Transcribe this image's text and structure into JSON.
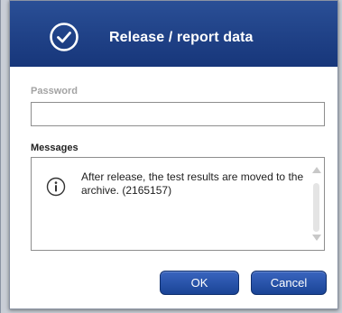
{
  "dialog": {
    "title": "Release / report data",
    "header_icon": "check-circle-icon",
    "accent_color": "#1f4389"
  },
  "password": {
    "label": "Password",
    "value": "",
    "placeholder": ""
  },
  "messages": {
    "label": "Messages",
    "icon": "info-icon",
    "text": "After release, the test results are moved to the archive. (2165157)"
  },
  "buttons": {
    "ok_label": "OK",
    "cancel_label": "Cancel"
  }
}
